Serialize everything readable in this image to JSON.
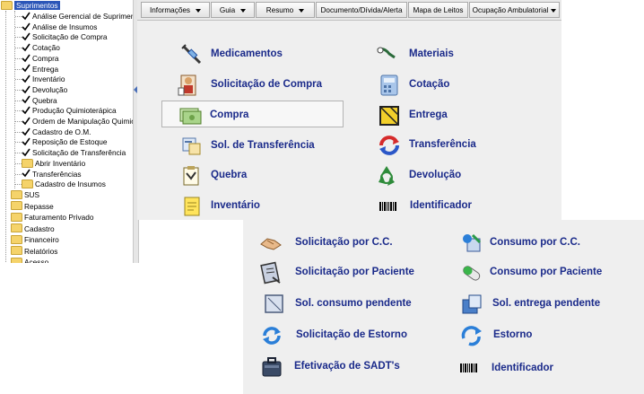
{
  "tree": {
    "root_label": "Suprimentos",
    "children": [
      "Análise Gerencial de Suprimentos",
      "Análise de Insumos",
      "Solicitação de Compra",
      "Cotação",
      "Compra",
      "Entrega",
      "Inventário",
      "Devolução",
      "Quebra",
      "Produção Quimioterápica",
      "Ordem de Manipulação Quimioterápica",
      "Cadastro de O.M.",
      "Reposição de Estoque",
      "Solicitação de Transferência",
      "Abrir Inventário",
      "Transferências",
      "Cadastro de Insumos"
    ],
    "top_folders": [
      "SUS",
      "Repasse",
      "Faturamento Privado",
      "Cadastro",
      "Financeiro",
      "Relatórios",
      "Acesso"
    ]
  },
  "toolbar": {
    "buttons": [
      "Informações",
      "Guia",
      "Resumo",
      "Documento/Dívida/Alerta",
      "Mapa de Leitos",
      "Ocupação Ambulatorial"
    ]
  },
  "main_menu": {
    "left": [
      "Medicamentos",
      "Solicitação de Compra",
      "Compra",
      "Sol. de Transferência",
      "Quebra",
      "Inventário"
    ],
    "right": [
      "Materiais",
      "Cotação",
      "Entrega",
      "Transferência",
      "Devolução",
      "Identificador"
    ]
  },
  "sub_menu": {
    "left": [
      "Solicitação por C.C.",
      "Solicitação por Paciente",
      "Sol. consumo pendente",
      "Solicitação de Estorno",
      "Efetivação de SADT's"
    ],
    "right": [
      "Consumo por C.C.",
      "Consumo por Paciente",
      "Sol. entrega pendente",
      "Estorno",
      "Identificador"
    ]
  },
  "colors": {
    "menu_text": "#1a2a8a",
    "tree_selection": "#2b56b8",
    "panel_bg": "#efefef"
  },
  "icons": {
    "main_left": [
      "syringe-icon",
      "purchase-request-icon",
      "purchase-icon",
      "transfer-request-icon",
      "broken-item-icon",
      "inventory-icon"
    ],
    "main_right": [
      "materials-icon",
      "calculator-icon",
      "delivery-box-icon",
      "transfer-arrows-icon",
      "recycle-icon",
      "barcode-icon"
    ],
    "sub_left": [
      "handshake-icon",
      "patient-request-icon",
      "pending-consumption-icon",
      "reversal-request-icon",
      "sadt-case-icon"
    ],
    "sub_right": [
      "consumption-cc-icon",
      "pill-icon",
      "pending-delivery-icon",
      "reversal-icon",
      "barcode-icon"
    ]
  }
}
